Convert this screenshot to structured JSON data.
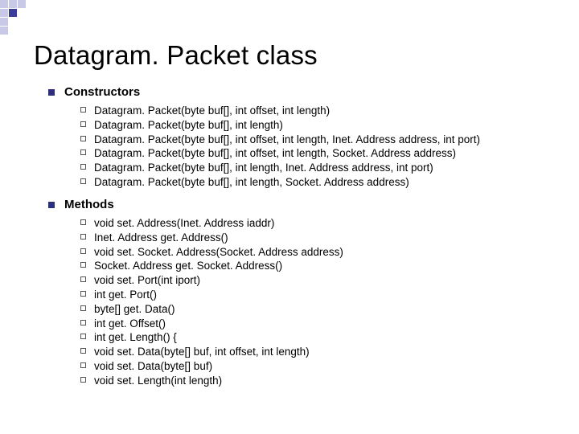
{
  "title": "Datagram. Packet class",
  "sections": [
    {
      "label": "Constructors",
      "items": [
        "Datagram. Packet(byte buf[], int offset, int length)",
        "Datagram. Packet(byte buf[], int length)",
        "Datagram. Packet(byte buf[], int offset, int length, Inet. Address address, int port)",
        "Datagram. Packet(byte buf[], int offset, int length, Socket. Address address)",
        "Datagram. Packet(byte buf[], int length, Inet. Address address, int port)",
        "Datagram. Packet(byte buf[], int length, Socket. Address address)"
      ]
    },
    {
      "label": "Methods",
      "items": [
        "void set. Address(Inet. Address iaddr)",
        "Inet. Address get. Address()",
        "void set. Socket. Address(Socket. Address address)",
        "Socket. Address get. Socket. Address()",
        "void set. Port(int iport)",
        "int get. Port()",
        "byte[] get. Data()",
        "int get. Offset()",
        "int get. Length() {",
        "void set. Data(byte[] buf, int offset, int length)",
        "void set. Data(byte[] buf)",
        "void set. Length(int length)"
      ]
    }
  ]
}
